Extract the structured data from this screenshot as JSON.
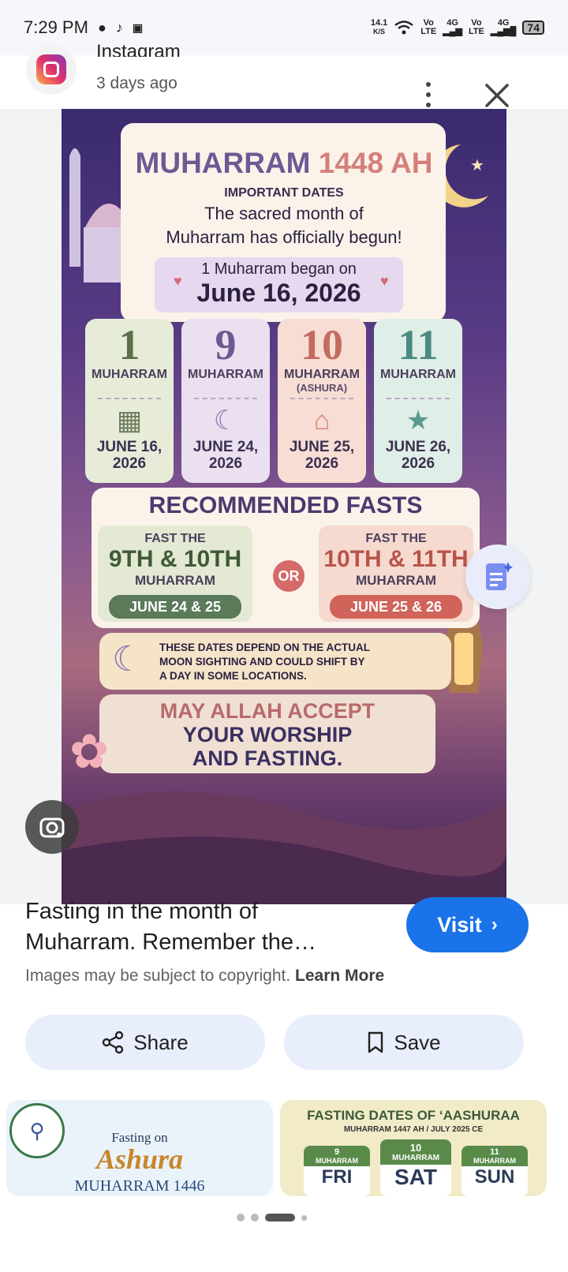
{
  "status": {
    "time": "7:29 PM",
    "net_speed_value": "14.1",
    "net_speed_unit": "K/S",
    "sim1_top": "Vo",
    "sim1_bottom": "LTE",
    "sim1_gen": "4G",
    "sim2_top": "Vo",
    "sim2_bottom": "LTE",
    "sim2_gen": "4G",
    "battery": "74"
  },
  "source": {
    "name": "Instagram",
    "time": "3 days ago"
  },
  "poster": {
    "title_word": "MUHARRAM",
    "title_year": "1448 AH",
    "subtitle": "IMPORTANT DATES",
    "line1": "The sacred month of",
    "line2": "Muharram has officially begun!",
    "began_small": "1 Muharram began on",
    "began_big": "June 16, 2026",
    "dates": [
      {
        "num": "1",
        "label": "MUHARRAM",
        "sub": "",
        "date_line1": "JUNE 16,",
        "date_line2": "2026"
      },
      {
        "num": "9",
        "label": "MUHARRAM",
        "sub": "",
        "date_line1": "JUNE 24,",
        "date_line2": "2026"
      },
      {
        "num": "10",
        "label": "MUHARRAM",
        "sub": "(ASHURA)",
        "date_line1": "JUNE 25,",
        "date_line2": "2026"
      },
      {
        "num": "11",
        "label": "MUHARRAM",
        "sub": "",
        "date_line1": "JUNE 26,",
        "date_line2": "2026"
      }
    ],
    "fasts_title": "RECOMMENDED FASTS",
    "fast_a": {
      "top": "FAST THE",
      "days": "9TH & 10TH",
      "month": "MUHARRAM",
      "dates": "JUNE 24 & 25"
    },
    "or": "OR",
    "fast_b": {
      "top": "FAST THE",
      "days": "10TH & 11TH",
      "month": "MUHARRAM",
      "dates": "JUNE 25 & 26"
    },
    "note_line1": "THESE DATES DEPEND ON THE ACTUAL",
    "note_line2": "MOON SIGHTING AND COULD SHIFT BY",
    "note_line3": "A DAY IN SOME LOCATIONS.",
    "bless_line1": "MAY ALLAH ACCEPT",
    "bless_line2": "YOUR WORSHIP",
    "bless_line3": "AND FASTING."
  },
  "caption": {
    "line1": "Fasting in the month of",
    "line2": "Muharram. Remember the…"
  },
  "visit_label": "Visit",
  "copyright_text": "Images may be subject to copyright.",
  "learn_more": "Learn More",
  "share_label": "Share",
  "save_label": "Save",
  "related": {
    "thumb1_line1": "Fasting on",
    "thumb1_line2": "Ashura",
    "thumb1_line3": "MUHARRAM 1446",
    "thumb2_title": "FASTING DATES OF ‘AASHURAA",
    "thumb2_sub": "MUHARRAM 1447 AH  /  JULY 2025 CE",
    "thumb2_days": [
      {
        "num": "9",
        "label": "MUHARRAM",
        "day": "FRI"
      },
      {
        "num": "10",
        "label": "MUHARRAM",
        "day": "SAT"
      },
      {
        "num": "11",
        "label": "MUHARRAM",
        "day": "SUN"
      }
    ]
  },
  "colors": {
    "accent": "#1a73e8",
    "poster_title": "#6c5a93",
    "poster_year": "#d4807a",
    "green_card": "#e7ecd9",
    "lilac_card": "#ebe0ef",
    "peach_card": "#f7ddd4",
    "mint_card": "#dfeee7"
  }
}
